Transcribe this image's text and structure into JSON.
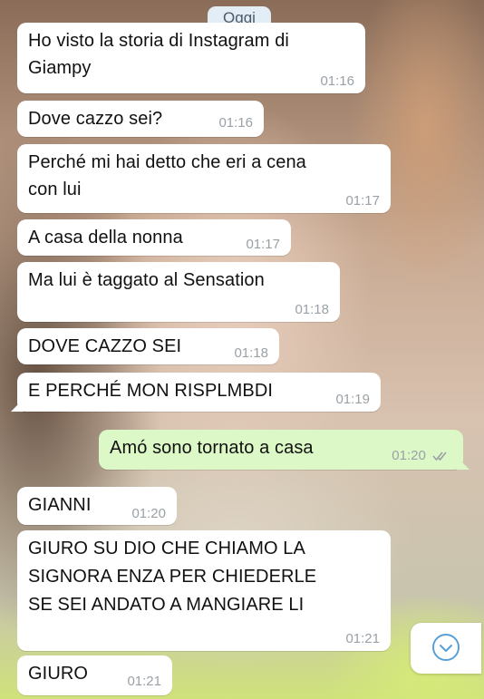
{
  "chat": {
    "day_label": "Oggi",
    "messages": [
      {
        "dir": "in",
        "text": "Ho visto la storia di Instagram di\nGiampy",
        "time": "01:16"
      },
      {
        "dir": "in",
        "text": "Dove cazzo sei?",
        "time": "01:16"
      },
      {
        "dir": "in",
        "text": "Perché mi hai detto che eri a cena\ncon lui",
        "time": "01:17"
      },
      {
        "dir": "in",
        "text": "A casa della nonna",
        "time": "01:17"
      },
      {
        "dir": "in",
        "text": "Ma lui è taggato al Sensation",
        "time": "01:18"
      },
      {
        "dir": "in",
        "text": "DOVE CAZZO SEI",
        "time": "01:18"
      },
      {
        "dir": "in",
        "text": "E PERCHÉ MON RISPLMBDI",
        "time": "01:19"
      },
      {
        "dir": "out",
        "text": "Amó sono tornato a casa",
        "time": "01:20",
        "status": "read-double-check"
      },
      {
        "dir": "in",
        "text": "GIANNI",
        "time": "01:20"
      },
      {
        "dir": "in",
        "text": "GIURO SU DIO CHE CHIAMO LA\nSIGNORA ENZA PER CHIEDERLE\nSE SEI ANDATO A MANGIARE LI",
        "time": "01:21"
      },
      {
        "dir": "in",
        "text": "GIURO",
        "time": "01:21"
      }
    ]
  },
  "scroll_button": {
    "icon": "chevron-down-icon"
  },
  "colors": {
    "incoming_bubble": "#ffffff",
    "outgoing_bubble": "#dcf8c6",
    "timestamp": "#9aa1a6",
    "day_pill": "#e3edf6",
    "read_ticks": "#9aa1a6",
    "scroll_icon": "#5aa0d8"
  }
}
